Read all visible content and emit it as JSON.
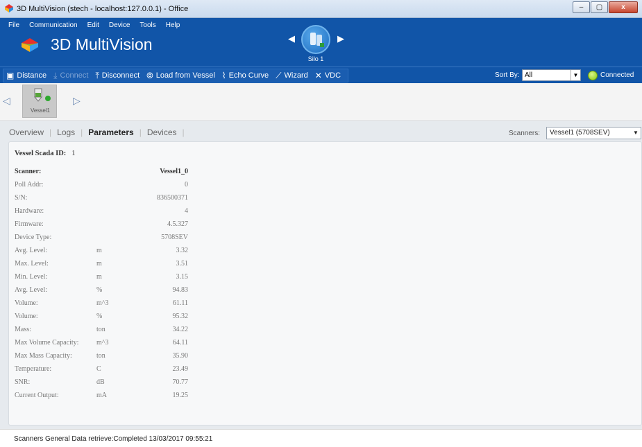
{
  "window": {
    "title": "3D MultiVision (stech - localhost:127.0.0.1) - Office",
    "buttons": {
      "minimize": "–",
      "maximize": "▢",
      "close": "x"
    }
  },
  "menu": [
    "File",
    "Communication",
    "Edit",
    "Device",
    "Tools",
    "Help"
  ],
  "app": {
    "name": "3D MultiVision"
  },
  "silo": {
    "label": "Silo 1"
  },
  "toolbar": {
    "distance": "Distance",
    "connect": "Connect",
    "disconnect": "Disconnect",
    "load_from_vessel": "Load from Vessel",
    "echo_curve": "Echo Curve",
    "wizard": "Wizard",
    "vdc": "VDC",
    "sort_by_label": "Sort By:",
    "sort_by_value": "All",
    "status": "Connected"
  },
  "vessel_tile": {
    "label": "Vessel1"
  },
  "tabs": [
    "Overview",
    "Logs",
    "Parameters",
    "Devices"
  ],
  "active_tab": "Parameters",
  "scanners": {
    "label": "Scanners:",
    "value": "Vessel1 (5708SEV)"
  },
  "vessel_scada": {
    "label": "Vessel Scada ID:",
    "value": "1"
  },
  "parameters": {
    "header": {
      "label": "Scanner:",
      "value": "Vessel1_0"
    },
    "rows": [
      {
        "label": "Poll Addr:",
        "unit": "",
        "value": "0"
      },
      {
        "label": "S/N:",
        "unit": "",
        "value": "836500371"
      },
      {
        "label": "Hardware:",
        "unit": "",
        "value": "4"
      },
      {
        "label": "Firmware:",
        "unit": "",
        "value": "4.5.327"
      },
      {
        "label": "Device Type:",
        "unit": "",
        "value": "5708SEV"
      },
      {
        "label": "Avg. Level:",
        "unit": "m",
        "value": "3.32"
      },
      {
        "label": "Max. Level:",
        "unit": "m",
        "value": "3.51"
      },
      {
        "label": "Min. Level:",
        "unit": "m",
        "value": "3.15"
      },
      {
        "label": "Avg. Level:",
        "unit": "%",
        "value": "94.83"
      },
      {
        "label": "Volume:",
        "unit": "m^3",
        "value": "61.11"
      },
      {
        "label": "Volume:",
        "unit": "%",
        "value": "95.32"
      },
      {
        "label": "Mass:",
        "unit": "ton",
        "value": "34.22"
      },
      {
        "label": "Max Volume Capacity:",
        "unit": "m^3",
        "value": "64.11"
      },
      {
        "label": "Max Mass Capacity:",
        "unit": "ton",
        "value": "35.90"
      },
      {
        "label": "Temperature:",
        "unit": "C",
        "value": "23.49"
      },
      {
        "label": "SNR:",
        "unit": "dB",
        "value": "70.77"
      },
      {
        "label": "Current Output:",
        "unit": "mA",
        "value": "19.25"
      }
    ]
  },
  "statusbar": {
    "text": "Scanners General Data retrieve:Completed 13/03/2017 09:55:21"
  },
  "colors": {
    "header": "#1155a8",
    "connected": "#8ac80e",
    "vessel_dot": "#2ea82e"
  }
}
